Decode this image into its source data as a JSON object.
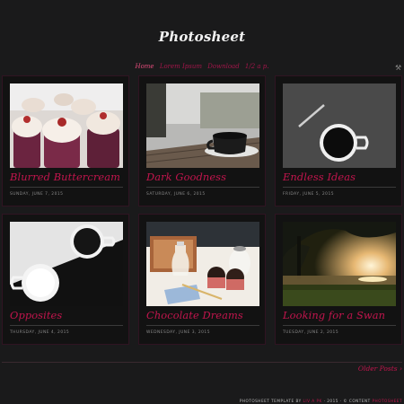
{
  "site": {
    "title": "Photosheet"
  },
  "nav": [
    {
      "label": "Home"
    },
    {
      "label": "Lorem Ipsum"
    },
    {
      "label": "Download"
    },
    {
      "label": "1/2 a p."
    }
  ],
  "icons": {
    "tools": "tools-icon"
  },
  "colors": {
    "accent": "#c2154d",
    "background": "#1a1a1b",
    "card": "#121212"
  },
  "posts": [
    {
      "title": "Blurred Buttercream",
      "date": "SUNDAY, JUNE 7, 2015"
    },
    {
      "title": "Dark Goodness",
      "date": "SATURDAY, JUNE 6, 2015"
    },
    {
      "title": "Endless Ideas",
      "date": "FRIDAY, JUNE 5, 2015"
    },
    {
      "title": "Opposites",
      "date": "THURSDAY, JUNE 4, 2015"
    },
    {
      "title": "Chocolate Dreams",
      "date": "WEDNESDAY, JUNE 3, 2015"
    },
    {
      "title": "Looking for a Swan",
      "date": "TUESDAY, JUNE 2, 2015"
    }
  ],
  "pagination": {
    "older": "Older Posts ›"
  },
  "footer": {
    "template_text": "PHOTOSHEET TEMPLATE BY",
    "author": "LIV A PK",
    "year_text": "· 2015 · © CONTENT",
    "content_link": "PHOTOSHEET"
  }
}
